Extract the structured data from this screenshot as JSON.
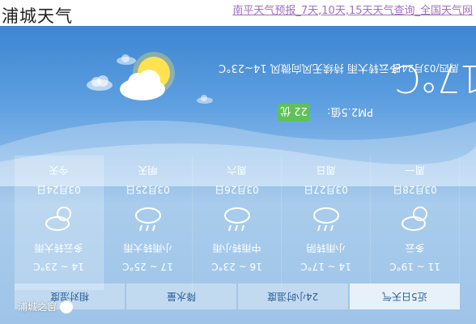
{
  "page": {
    "title": "浦城天气",
    "ad_link": "南平天气预报_7天,10天,15天天气查询_全国天气网"
  },
  "current": {
    "date_weekday": "周四/03月24日",
    "condition_wind": "多云转大雨  持续无风向微风  14~23°C",
    "temperature": "17°C",
    "pm_label": "PM2.5值:",
    "pm_badge": "22 优",
    "pm_color": "#5fc15a"
  },
  "days": [
    {
      "label": "今天",
      "date": "03月24日",
      "icon": "sun-cloud-icon",
      "condition": "多云转大雨",
      "range": "14 ~ 23°C"
    },
    {
      "label": "明天",
      "date": "03月25日",
      "icon": "rain-cloud-icon",
      "condition": "小雨转大雨",
      "range": "17 ~ 25°C"
    },
    {
      "label": "周六",
      "date": "03月26日",
      "icon": "rain-cloud-icon",
      "condition": "中雨转小雨",
      "range": "16 ~ 23°C"
    },
    {
      "label": "周日",
      "date": "03月27日",
      "icon": "rain-cloud-icon",
      "condition": "小雨转阴",
      "range": "14 ~ 17°C"
    },
    {
      "label": "周一",
      "date": "03月28日",
      "icon": "sun-cloud-icon",
      "condition": "多云",
      "range": "11 ~ 19°C"
    }
  ],
  "tabs": [
    {
      "label": "近5日天气",
      "active": true
    },
    {
      "label": "24小时温度"
    },
    {
      "label": "降水量"
    },
    {
      "label": "相对湿度"
    }
  ],
  "watermark": "浦城之窗",
  "colors": {
    "sky_top": "#3d86d2",
    "sky_bottom": "#a9ccec"
  }
}
